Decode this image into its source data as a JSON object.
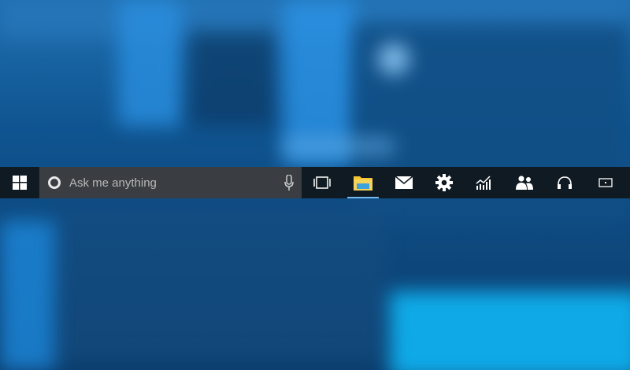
{
  "search": {
    "placeholder": "Ask me anything"
  },
  "taskbar": {
    "start_icon": "windows-logo-icon",
    "search_icon": "cortana-icon",
    "mic_icon": "microphone-icon",
    "apps": [
      {
        "name": "task-view",
        "icon": "task-view-icon"
      },
      {
        "name": "file-explorer",
        "icon": "folder-icon"
      },
      {
        "name": "mail",
        "icon": "mail-icon"
      },
      {
        "name": "settings",
        "icon": "gear-icon"
      },
      {
        "name": "stocks",
        "icon": "chart-icon"
      },
      {
        "name": "people",
        "icon": "people-icon"
      },
      {
        "name": "music",
        "icon": "headphones-icon"
      },
      {
        "name": "media",
        "icon": "media-icon"
      }
    ]
  },
  "colors": {
    "taskbar_bg": "#101a22",
    "search_bg": "#3a3e42",
    "folder_yellow": "#f3c531",
    "folder_blue": "#3ea2dc"
  }
}
